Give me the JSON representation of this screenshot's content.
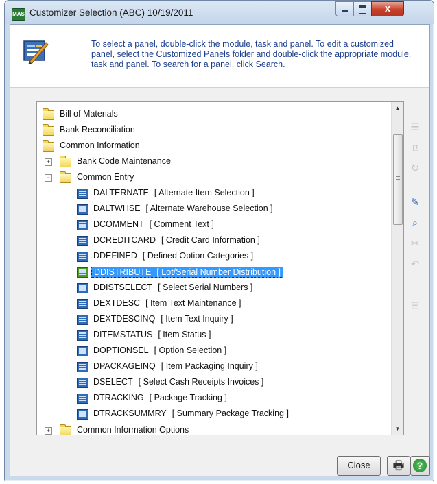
{
  "window": {
    "app_icon_text": "MAS",
    "title": "Customizer Selection (ABC) 10/19/2011",
    "minimize_glyph": "",
    "maximize_glyph": "",
    "close_glyph": "x"
  },
  "header": {
    "instructions": "To select a panel, double-click the module, task and panel. To edit a customized panel, select the Customized Panels folder and double-click the appropriate module, task and panel. To search for a panel, click Search."
  },
  "tree": {
    "folders": [
      {
        "label": "Bill of Materials"
      },
      {
        "label": "Bank Reconciliation"
      },
      {
        "label": "Common Information"
      },
      {
        "label": "Bank Code Maintenance"
      },
      {
        "label": "Common Entry"
      }
    ],
    "panels": [
      {
        "name": "DALTERNATE",
        "desc": "[ Alternate Item Selection ]"
      },
      {
        "name": "DALTWHSE",
        "desc": "[ Alternate Warehouse Selection ]"
      },
      {
        "name": "DCOMMENT",
        "desc": "[ Comment Text ]"
      },
      {
        "name": "DCREDITCARD",
        "desc": "[ Credit Card Information ]"
      },
      {
        "name": "DDEFINED",
        "desc": "[ Defined Option Categories ]"
      },
      {
        "name": "DDISTRIBUTE",
        "desc": "[ Lot/Serial Number Distribution ]"
      },
      {
        "name": "DDISTSELECT",
        "desc": "[ Select Serial Numbers ]"
      },
      {
        "name": "DEXTDESC",
        "desc": "[ Item Text Maintenance ]"
      },
      {
        "name": "DEXTDESCINQ",
        "desc": "[ Item Text Inquiry ]"
      },
      {
        "name": "DITEMSTATUS",
        "desc": "[ Item Status ]"
      },
      {
        "name": "DOPTIONSEL",
        "desc": "[ Option Selection ]"
      },
      {
        "name": "DPACKAGEINQ",
        "desc": "[ Item Packaging Inquiry ]"
      },
      {
        "name": "DSELECT",
        "desc": "[ Select Cash Receipts Invoices ]"
      },
      {
        "name": "DTRACKING",
        "desc": "[ Package Tracking ]"
      },
      {
        "name": "DTRACKSUMMRY",
        "desc": "[ Summary Package Tracking ]"
      }
    ],
    "partial_folder": {
      "label": "Common Information Options"
    },
    "selected_panel": "DDISTRIBUTE",
    "expander_collapsed": "+",
    "expander_expanded": "−"
  },
  "scrollbar": {
    "up_arrow": "▲",
    "down_arrow": "▼"
  },
  "toolbar": {
    "icons": [
      "list-icon",
      "copy-icon",
      "refresh-icon",
      "customize-icon",
      "search-icon",
      "tools-icon",
      "undo-icon",
      "remove-icon"
    ]
  },
  "footer": {
    "close_label": "Close",
    "print_glyph": "🖶",
    "help_glyph": "?"
  }
}
